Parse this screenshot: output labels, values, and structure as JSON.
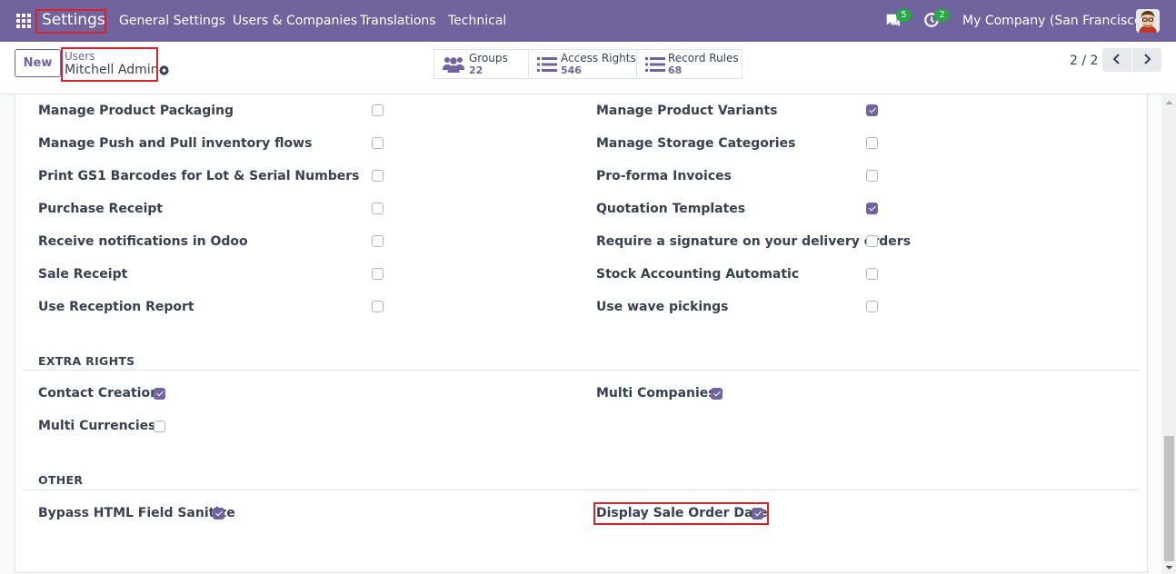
{
  "navbar": {
    "brand": "Settings",
    "menus": [
      "General Settings",
      "Users & Companies",
      "Translations",
      "Technical"
    ],
    "messages_count": "5",
    "activities_count": "2",
    "company": "My Company (San Francisco)",
    "icons": {
      "apps": "apps-grid-icon",
      "messages": "chat-bubble-icon",
      "activities": "clock-activity-icon",
      "avatar": "user-avatar"
    }
  },
  "control_panel": {
    "new_label": "New",
    "breadcrumb_parent": "Users",
    "breadcrumb_current": "Mitchell Admin",
    "stats": [
      {
        "label": "Groups",
        "value": "22",
        "icon": "users-group-icon"
      },
      {
        "label": "Access Rights",
        "value": "546",
        "icon": "list-icon"
      },
      {
        "label": "Record Rules",
        "value": "68",
        "icon": "list-icon"
      }
    ],
    "pager": "2 / 2"
  },
  "technical_rows": [
    {
      "left": {
        "label": "Manage Product Packaging",
        "checked": false
      },
      "right": {
        "label": "Manage Product Variants",
        "checked": true
      }
    },
    {
      "left": {
        "label": "Manage Push and Pull inventory flows",
        "checked": false
      },
      "right": {
        "label": "Manage Storage Categories",
        "checked": false
      }
    },
    {
      "left": {
        "label": "Print GS1 Barcodes for Lot & Serial Numbers",
        "checked": false
      },
      "right": {
        "label": "Pro-forma Invoices",
        "checked": false
      }
    },
    {
      "left": {
        "label": "Purchase Receipt",
        "checked": false
      },
      "right": {
        "label": "Quotation Templates",
        "checked": true
      }
    },
    {
      "left": {
        "label": "Receive notifications in Odoo",
        "checked": false
      },
      "right": {
        "label": "Require a signature on your delivery orders",
        "checked": false
      }
    },
    {
      "left": {
        "label": "Sale Receipt",
        "checked": false
      },
      "right": {
        "label": "Stock Accounting Automatic",
        "checked": false
      }
    },
    {
      "left": {
        "label": "Use Reception Report",
        "checked": false
      },
      "right": {
        "label": "Use wave pickings",
        "checked": false
      }
    }
  ],
  "extra_rights": {
    "title": "EXTRA RIGHTS",
    "items": [
      {
        "label": "Contact Creation",
        "checked": true
      },
      {
        "label": "Multi Companies",
        "checked": true
      },
      {
        "label": "Multi Currencies",
        "checked": false
      }
    ]
  },
  "other": {
    "title": "OTHER",
    "items": [
      {
        "label": "Bypass HTML Field Sanitize",
        "checked": true
      },
      {
        "label": "Display Sale Order Date",
        "checked": true
      }
    ]
  },
  "colors": {
    "primary": "#71639e",
    "badge": "#28a745",
    "highlight": "#d8232a"
  }
}
